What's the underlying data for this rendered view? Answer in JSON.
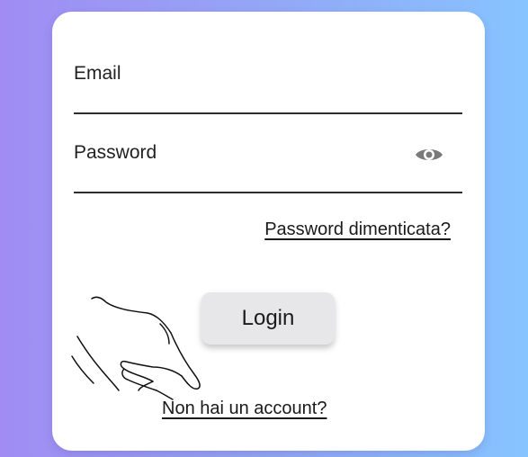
{
  "form": {
    "email_placeholder": "Email",
    "password_placeholder": "Password",
    "forgot_password_label": "Password dimenticata?",
    "login_label": "Login",
    "signup_label": "Non hai un account?"
  },
  "icons": {
    "password_toggle": "eye-icon",
    "pointer": "pointing-hand-icon"
  },
  "colors": {
    "gradient_start": "#a08cf3",
    "gradient_end": "#86c4ff",
    "card": "#ffffff",
    "button": "#e7e7e9",
    "text": "#1a1a1a"
  }
}
